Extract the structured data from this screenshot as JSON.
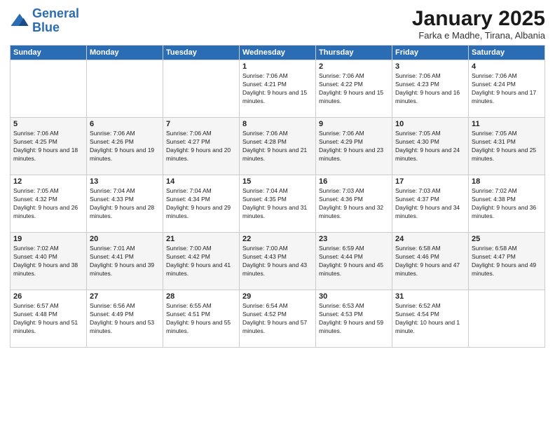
{
  "header": {
    "logo_line1": "General",
    "logo_line2": "Blue",
    "month": "January 2025",
    "location": "Farka e Madhe, Tirana, Albania"
  },
  "days_of_week": [
    "Sunday",
    "Monday",
    "Tuesday",
    "Wednesday",
    "Thursday",
    "Friday",
    "Saturday"
  ],
  "weeks": [
    [
      {
        "day": null
      },
      {
        "day": null
      },
      {
        "day": null
      },
      {
        "day": "1",
        "sunrise": "7:06 AM",
        "sunset": "4:21 PM",
        "daylight": "9 hours and 15 minutes."
      },
      {
        "day": "2",
        "sunrise": "7:06 AM",
        "sunset": "4:22 PM",
        "daylight": "9 hours and 15 minutes."
      },
      {
        "day": "3",
        "sunrise": "7:06 AM",
        "sunset": "4:23 PM",
        "daylight": "9 hours and 16 minutes."
      },
      {
        "day": "4",
        "sunrise": "7:06 AM",
        "sunset": "4:24 PM",
        "daylight": "9 hours and 17 minutes."
      }
    ],
    [
      {
        "day": "5",
        "sunrise": "7:06 AM",
        "sunset": "4:25 PM",
        "daylight": "9 hours and 18 minutes."
      },
      {
        "day": "6",
        "sunrise": "7:06 AM",
        "sunset": "4:26 PM",
        "daylight": "9 hours and 19 minutes."
      },
      {
        "day": "7",
        "sunrise": "7:06 AM",
        "sunset": "4:27 PM",
        "daylight": "9 hours and 20 minutes."
      },
      {
        "day": "8",
        "sunrise": "7:06 AM",
        "sunset": "4:28 PM",
        "daylight": "9 hours and 21 minutes."
      },
      {
        "day": "9",
        "sunrise": "7:06 AM",
        "sunset": "4:29 PM",
        "daylight": "9 hours and 23 minutes."
      },
      {
        "day": "10",
        "sunrise": "7:05 AM",
        "sunset": "4:30 PM",
        "daylight": "9 hours and 24 minutes."
      },
      {
        "day": "11",
        "sunrise": "7:05 AM",
        "sunset": "4:31 PM",
        "daylight": "9 hours and 25 minutes."
      }
    ],
    [
      {
        "day": "12",
        "sunrise": "7:05 AM",
        "sunset": "4:32 PM",
        "daylight": "9 hours and 26 minutes."
      },
      {
        "day": "13",
        "sunrise": "7:04 AM",
        "sunset": "4:33 PM",
        "daylight": "9 hours and 28 minutes."
      },
      {
        "day": "14",
        "sunrise": "7:04 AM",
        "sunset": "4:34 PM",
        "daylight": "9 hours and 29 minutes."
      },
      {
        "day": "15",
        "sunrise": "7:04 AM",
        "sunset": "4:35 PM",
        "daylight": "9 hours and 31 minutes."
      },
      {
        "day": "16",
        "sunrise": "7:03 AM",
        "sunset": "4:36 PM",
        "daylight": "9 hours and 32 minutes."
      },
      {
        "day": "17",
        "sunrise": "7:03 AM",
        "sunset": "4:37 PM",
        "daylight": "9 hours and 34 minutes."
      },
      {
        "day": "18",
        "sunrise": "7:02 AM",
        "sunset": "4:38 PM",
        "daylight": "9 hours and 36 minutes."
      }
    ],
    [
      {
        "day": "19",
        "sunrise": "7:02 AM",
        "sunset": "4:40 PM",
        "daylight": "9 hours and 38 minutes."
      },
      {
        "day": "20",
        "sunrise": "7:01 AM",
        "sunset": "4:41 PM",
        "daylight": "9 hours and 39 minutes."
      },
      {
        "day": "21",
        "sunrise": "7:00 AM",
        "sunset": "4:42 PM",
        "daylight": "9 hours and 41 minutes."
      },
      {
        "day": "22",
        "sunrise": "7:00 AM",
        "sunset": "4:43 PM",
        "daylight": "9 hours and 43 minutes."
      },
      {
        "day": "23",
        "sunrise": "6:59 AM",
        "sunset": "4:44 PM",
        "daylight": "9 hours and 45 minutes."
      },
      {
        "day": "24",
        "sunrise": "6:58 AM",
        "sunset": "4:46 PM",
        "daylight": "9 hours and 47 minutes."
      },
      {
        "day": "25",
        "sunrise": "6:58 AM",
        "sunset": "4:47 PM",
        "daylight": "9 hours and 49 minutes."
      }
    ],
    [
      {
        "day": "26",
        "sunrise": "6:57 AM",
        "sunset": "4:48 PM",
        "daylight": "9 hours and 51 minutes."
      },
      {
        "day": "27",
        "sunrise": "6:56 AM",
        "sunset": "4:49 PM",
        "daylight": "9 hours and 53 minutes."
      },
      {
        "day": "28",
        "sunrise": "6:55 AM",
        "sunset": "4:51 PM",
        "daylight": "9 hours and 55 minutes."
      },
      {
        "day": "29",
        "sunrise": "6:54 AM",
        "sunset": "4:52 PM",
        "daylight": "9 hours and 57 minutes."
      },
      {
        "day": "30",
        "sunrise": "6:53 AM",
        "sunset": "4:53 PM",
        "daylight": "9 hours and 59 minutes."
      },
      {
        "day": "31",
        "sunrise": "6:52 AM",
        "sunset": "4:54 PM",
        "daylight": "10 hours and 1 minute."
      },
      {
        "day": null
      }
    ]
  ]
}
